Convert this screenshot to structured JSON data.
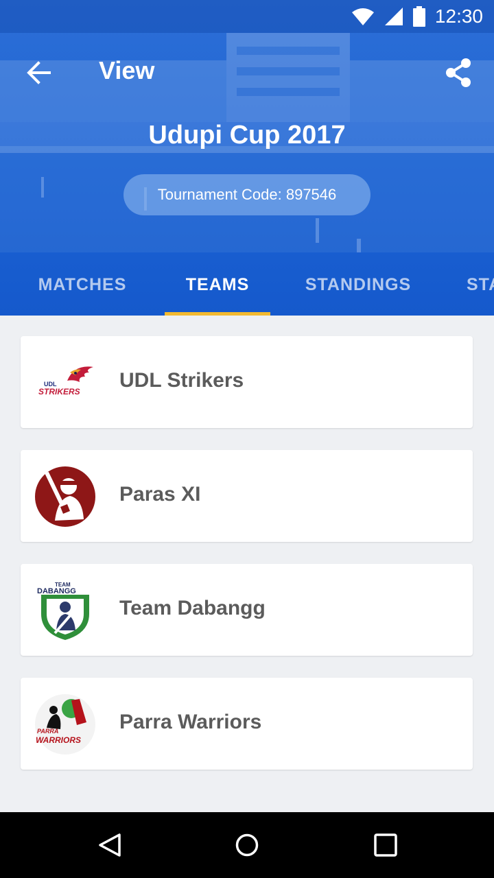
{
  "status_bar": {
    "time": "12:30",
    "icons": [
      "wifi-icon",
      "signal-icon",
      "battery-icon"
    ]
  },
  "toolbar": {
    "back_icon": "arrow-back-icon",
    "title": "View",
    "share_icon": "share-icon"
  },
  "tournament": {
    "name": "Udupi Cup 2017",
    "code_label": "Tournament Code: 897546"
  },
  "tabs": [
    {
      "label": "MATCHES",
      "active": false
    },
    {
      "label": "TEAMS",
      "active": true
    },
    {
      "label": "STANDINGS",
      "active": false
    },
    {
      "label": "STATS",
      "active": false
    }
  ],
  "teams": [
    {
      "name": "UDL Strikers",
      "logo": "udl-strikers-logo"
    },
    {
      "name": "Paras XI",
      "logo": "paras-xi-logo"
    },
    {
      "name": "Team Dabangg",
      "logo": "team-dabangg-logo"
    },
    {
      "name": "Parra Warriors",
      "logo": "parra-warriors-logo"
    }
  ],
  "logo_text": {
    "udl": "UDL",
    "strikers": "STRIKERS",
    "team": "TEAM",
    "dabangg": "DABANGG",
    "parra": "PARRA",
    "warriors": "WARRIORS"
  },
  "nav_bar": {
    "icons": [
      "back-triangle-icon",
      "home-circle-icon",
      "recents-square-icon"
    ]
  },
  "colors": {
    "header_blue": "#1c63d4",
    "tab_indicator": "#f2b930",
    "background": "#eef0f3",
    "team_name": "#5b5b5b"
  }
}
